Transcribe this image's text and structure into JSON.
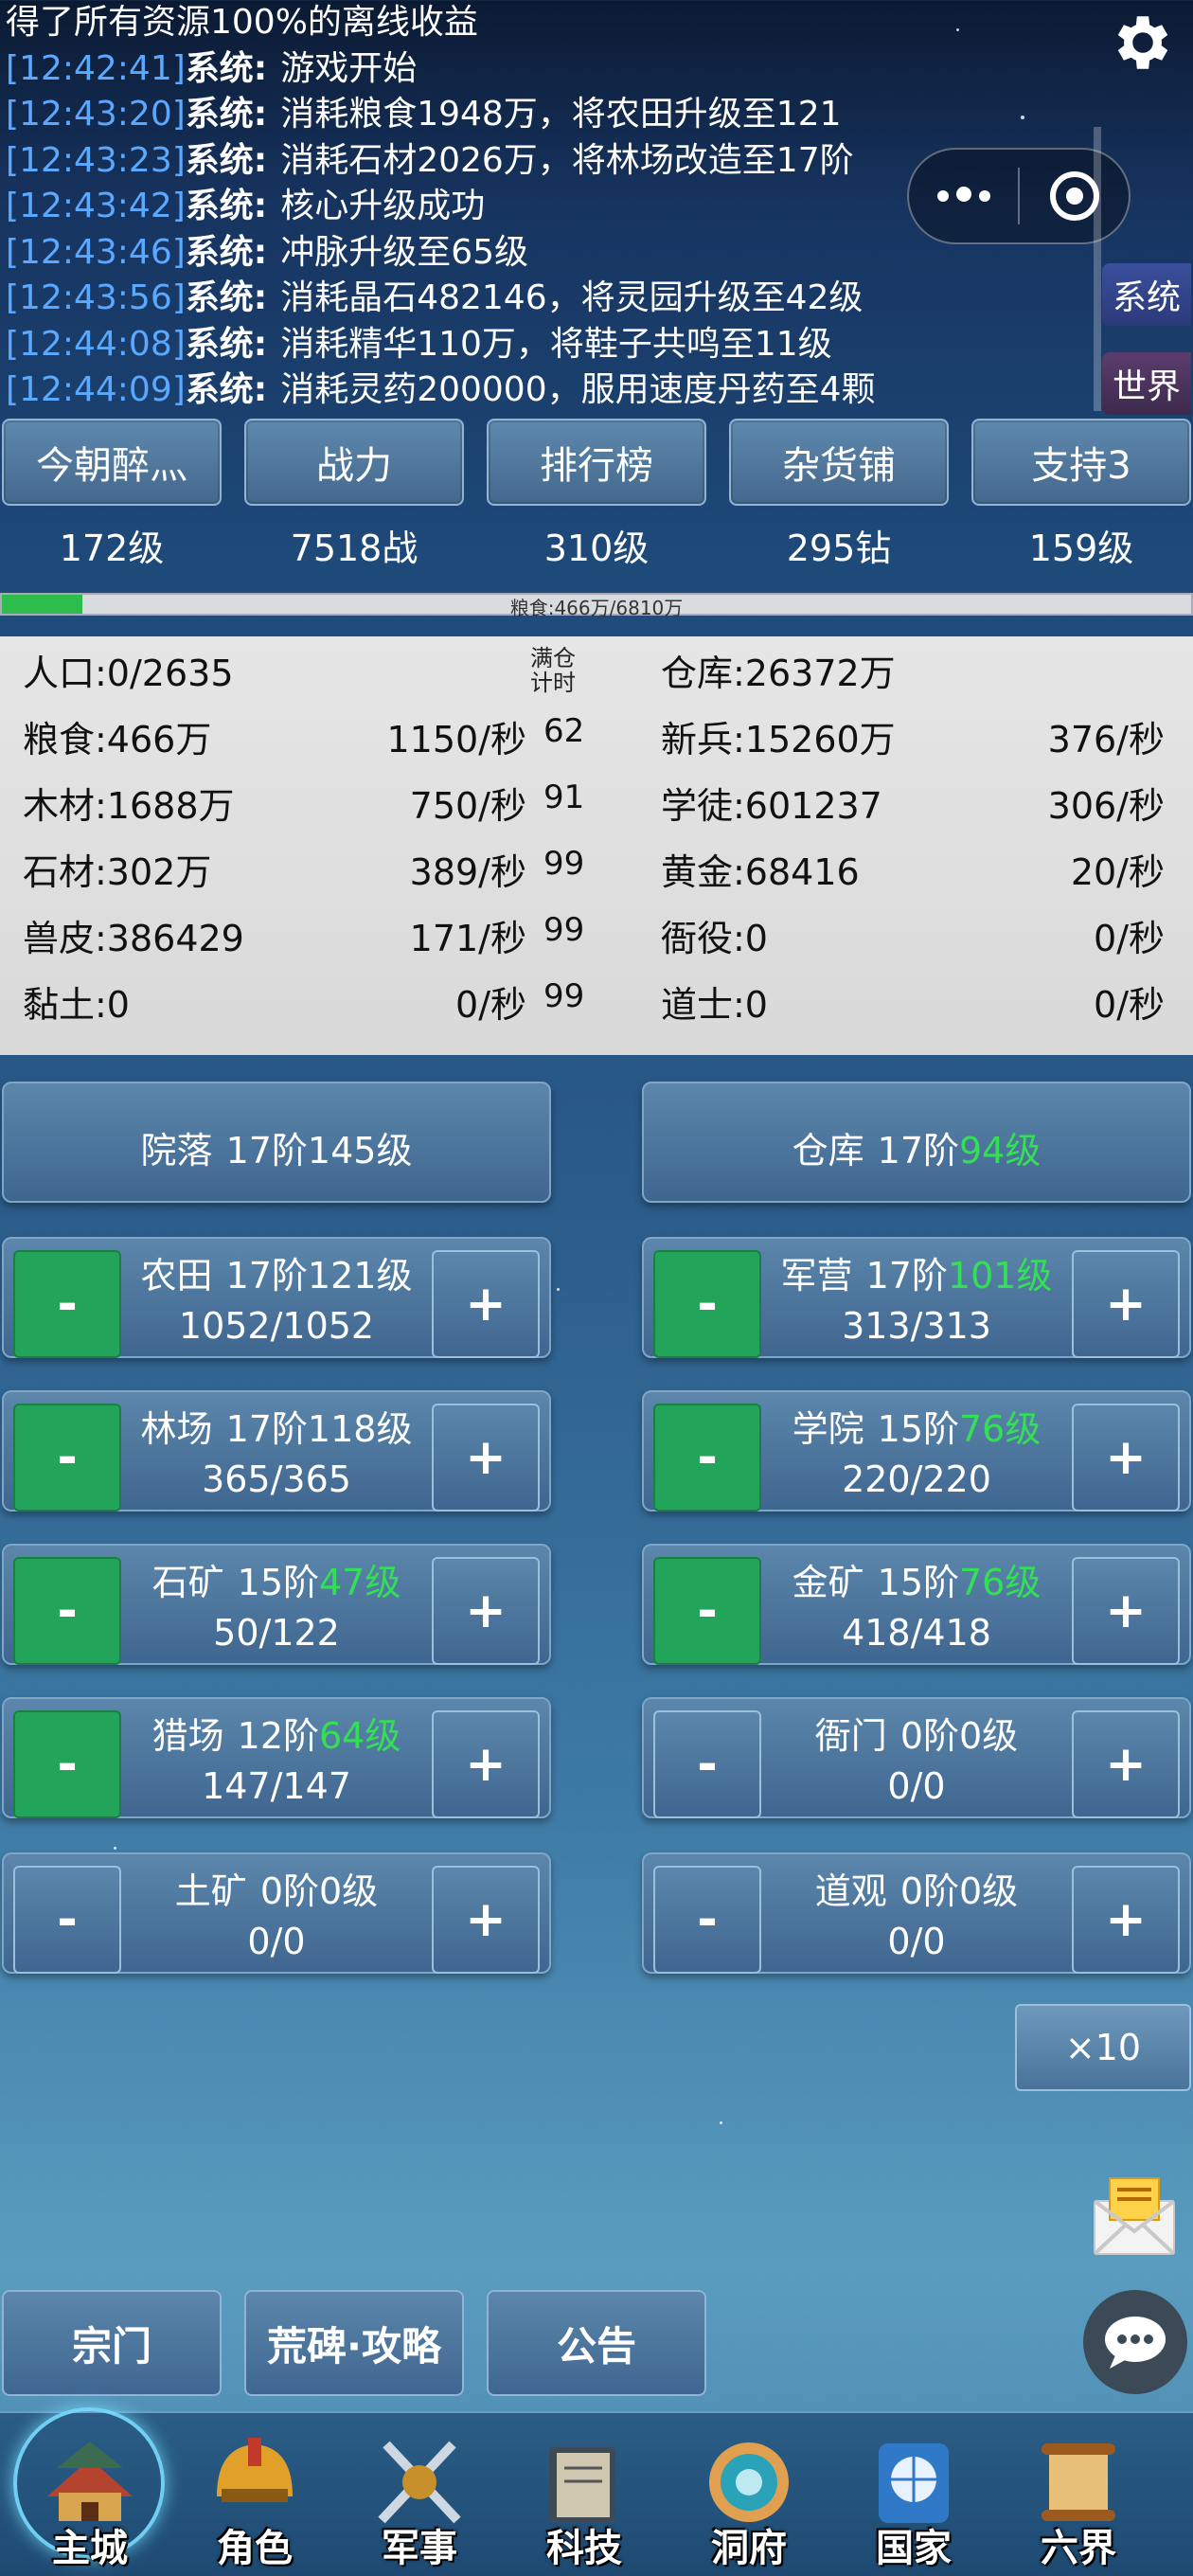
{
  "log": [
    {
      "time": "",
      "source": "",
      "text": "得了所有资源100%的离线收益"
    },
    {
      "time": "[12:42:41]",
      "source": "系统:",
      "text": "游戏开始"
    },
    {
      "time": "[12:43:20]",
      "source": "系统:",
      "text": "消耗粮食1948万，将农田升级至121"
    },
    {
      "time": "[12:43:23]",
      "source": "系统:",
      "text": "消耗石材2026万，将林场改造至17阶"
    },
    {
      "time": "[12:43:42]",
      "source": "系统:",
      "text": "核心升级成功"
    },
    {
      "time": "[12:43:46]",
      "source": "系统:",
      "text": "冲脉升级至65级"
    },
    {
      "time": "[12:43:56]",
      "source": "系统:",
      "text": "消耗晶石482146，将灵园升级至42级"
    },
    {
      "time": "[12:44:08]",
      "source": "系统:",
      "text": "消耗精华110万，将鞋子共鸣至11级"
    },
    {
      "time": "[12:44:09]",
      "source": "系统:",
      "text": "消耗灵药200000，服用速度丹药至4颗"
    }
  ],
  "side_tabs": {
    "system": "系统",
    "world": "世界"
  },
  "top_buttons": [
    "今朝醉灬",
    "战力",
    "排行榜",
    "杂货铺",
    "支持3"
  ],
  "stats": [
    "172级",
    "7518战",
    "310级",
    "295钻",
    "159级"
  ],
  "progress": {
    "label": "粮食:466万/6810万",
    "fraction": 0.068
  },
  "resources": {
    "caption": "满仓\n计时",
    "left": [
      {
        "name": "人口:0/2635",
        "rate": "",
        "cap": ""
      },
      {
        "name": "粮食:466万",
        "rate": "1150/秒",
        "cap": "62"
      },
      {
        "name": "木材:1688万",
        "rate": "750/秒",
        "cap": "91"
      },
      {
        "name": "石材:302万",
        "rate": "389/秒",
        "cap": "99"
      },
      {
        "name": "兽皮:386429",
        "rate": "171/秒",
        "cap": "99"
      },
      {
        "name": "黏土:0",
        "rate": "0/秒",
        "cap": "99"
      }
    ],
    "right": [
      {
        "name": "仓库:26372万",
        "rate": ""
      },
      {
        "name": "新兵:15260万",
        "rate": "376/秒"
      },
      {
        "name": "学徒:601237",
        "rate": "306/秒"
      },
      {
        "name": "黄金:68416",
        "rate": "20/秒"
      },
      {
        "name": "衙役:0",
        "rate": "0/秒"
      },
      {
        "name": "道士:0",
        "rate": "0/秒"
      }
    ]
  },
  "buildings": {
    "courtyard": {
      "name": "院落",
      "tier": "17阶",
      "level": "145级",
      "level_green": false
    },
    "warehouse": {
      "name": "仓库",
      "tier": "17阶",
      "level": "94级",
      "level_green": true
    },
    "farm": {
      "name": "农田",
      "tier": "17阶",
      "level": "121级",
      "level_green": false,
      "count": "1052/1052",
      "active": true
    },
    "barracks": {
      "name": "军营",
      "tier": "17阶",
      "level": "101级",
      "level_green": true,
      "count": "313/313",
      "active": true
    },
    "lumber": {
      "name": "林场",
      "tier": "17阶",
      "level": "118级",
      "level_green": false,
      "count": "365/365",
      "active": true
    },
    "academy": {
      "name": "学院",
      "tier": "15阶",
      "level": "76级",
      "level_green": true,
      "count": "220/220",
      "active": true
    },
    "quarry": {
      "name": "石矿",
      "tier": "15阶",
      "level": "47级",
      "level_green": true,
      "count": "50/122",
      "active": true
    },
    "goldmine": {
      "name": "金矿",
      "tier": "15阶",
      "level": "76级",
      "level_green": true,
      "count": "418/418",
      "active": true
    },
    "hunting": {
      "name": "猎场",
      "tier": "12阶",
      "level": "64级",
      "level_green": true,
      "count": "147/147",
      "active": true
    },
    "yamen": {
      "name": "衙门",
      "tier": "0阶",
      "level": "0级",
      "level_green": false,
      "count": "0/0",
      "active": false
    },
    "claymine": {
      "name": "土矿",
      "tier": "0阶",
      "level": "0级",
      "level_green": false,
      "count": "0/0",
      "active": false
    },
    "temple": {
      "name": "道观",
      "tier": "0阶",
      "level": "0级",
      "level_green": false,
      "count": "0/0",
      "active": false
    }
  },
  "controls": {
    "minus": "-",
    "plus": "+",
    "multiplier": "×10"
  },
  "bottom_buttons": [
    "宗门",
    "荒碑·攻略",
    "公告"
  ],
  "nav": [
    "主城",
    "角色",
    "军事",
    "科技",
    "洞府",
    "国家",
    "六界"
  ],
  "colors": {
    "accent_green": "#33e055",
    "time_blue": "#5aa8ff",
    "active_btn": "#22a55a"
  }
}
